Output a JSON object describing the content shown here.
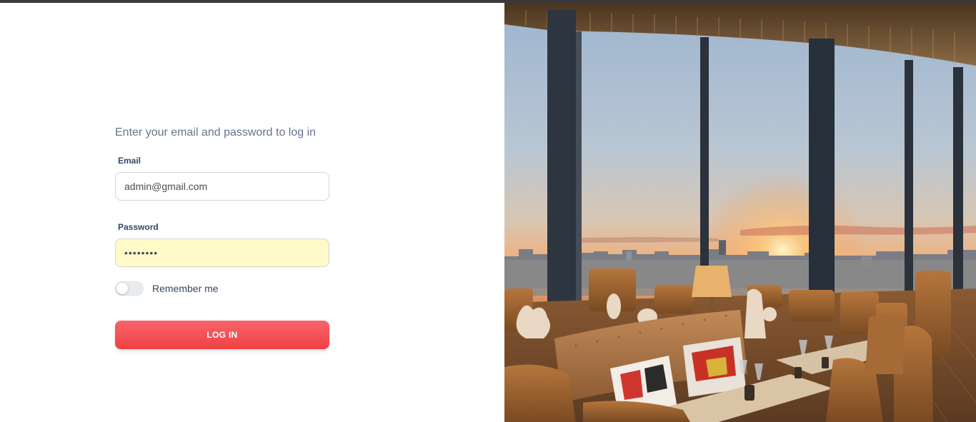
{
  "login": {
    "subtitle": "Enter your email and password to log in",
    "email_label": "Email",
    "email_value": "admin@gmail.com",
    "password_label": "Password",
    "password_value": "••••••••",
    "remember_label": "Remember me",
    "remember_checked": false,
    "submit_label": "LOG IN"
  },
  "colors": {
    "primary_button": "#f5474c",
    "autofill_bg": "#fffac8",
    "label_text": "#344767",
    "muted_text": "#67748e"
  },
  "hero_image": {
    "scene": "restaurant-sunset-panorama"
  }
}
